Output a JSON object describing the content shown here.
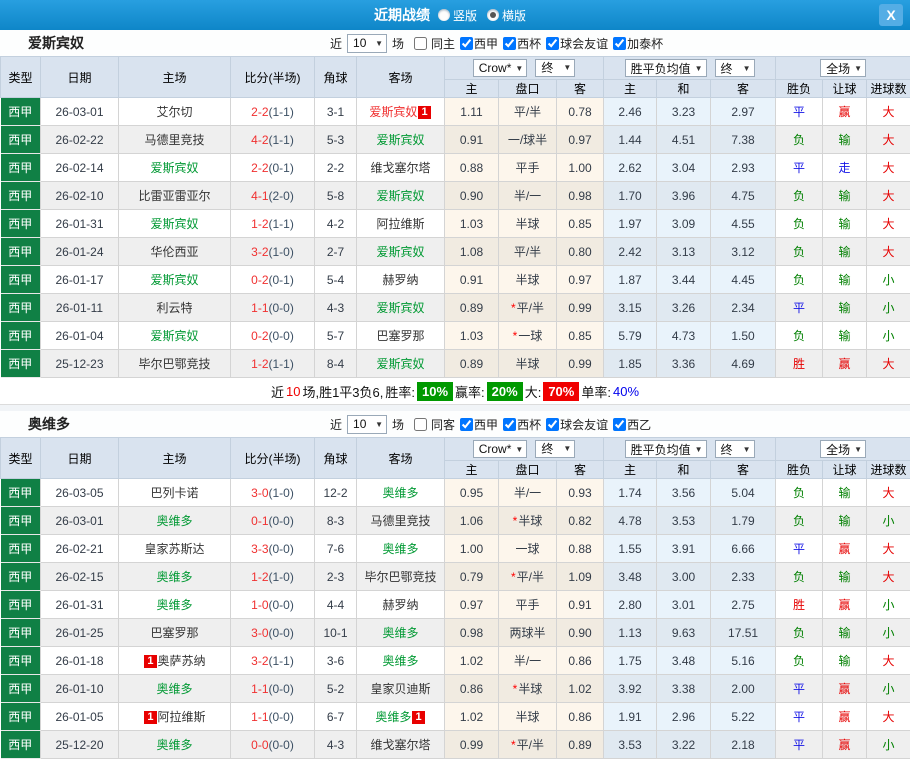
{
  "title_bar": {
    "title": "近期战绩",
    "radio_vertical": "竖版",
    "radio_horizontal": "横版",
    "selected": "横版",
    "close_label": "X"
  },
  "glyphs": {
    "star": "*",
    "dropdown_arrow": "▼"
  },
  "colors": {
    "titlebar_blue": "#1591da",
    "league_green": "#108045",
    "focus_team_green": "#009933",
    "win_box_green": "#009900",
    "loss_box_red": "#f00000",
    "draw_blue": "#1414e6"
  },
  "columns": {
    "type": "类型",
    "date": "日期",
    "home": "主场",
    "score": "比分(半场)",
    "corner": "角球",
    "away": "客场",
    "odds_home": "主",
    "odds_line": "盘口",
    "odds_away": "客",
    "mean_home": "主",
    "mean_draw": "和",
    "mean_away": "客",
    "result_wdl": "胜负",
    "result_ah": "让球",
    "result_ou": "进球数",
    "dd_crow": "Crow*",
    "dd_final1": "终",
    "dd_mean": "胜平负均值",
    "dd_final2": "终",
    "dd_fulltime": "全场"
  },
  "section1": {
    "team": "爱斯宾奴",
    "near": "近",
    "count": "10",
    "games": "场",
    "same": "同主",
    "comps": [
      "西甲",
      "西杯",
      "球会友谊",
      "加泰杯"
    ],
    "summary": {
      "near": "近",
      "count": "10",
      "body": "场,胜1平3负6, ",
      "win_label": "胜率:",
      "win_pct": "10%",
      "ah_label": "赢率:",
      "ah_pct": "20%",
      "ou_label": "大:",
      "ou_pct": "70%",
      "single_label": "单率:",
      "single_pct": "40%"
    },
    "rows": [
      {
        "lg": "西甲",
        "date": "26-03-01",
        "home": {
          "name": "艾尔切",
          "cls": "dark"
        },
        "score": {
          "ft": "2-2",
          "ht": "(1-1)"
        },
        "corner": "3-1",
        "away": {
          "name": "爱斯宾奴",
          "cls": "red",
          "post": "1"
        },
        "odds": {
          "h": "1.11",
          "line": "平/半",
          "star": false,
          "a": "0.78"
        },
        "mean": {
          "h": "2.46",
          "d": "3.23",
          "a": "2.97"
        },
        "res": {
          "wdl": "平",
          "ah": "赢",
          "ou": "大"
        }
      },
      {
        "lg": "西甲",
        "date": "26-02-22",
        "home": {
          "name": "马德里竞技",
          "cls": "dark"
        },
        "score": {
          "ft": "4-2",
          "ht": "(1-1)"
        },
        "corner": "5-3",
        "away": {
          "name": "爱斯宾奴",
          "cls": "green"
        },
        "odds": {
          "h": "0.91",
          "line": "一/球半",
          "star": false,
          "a": "0.97"
        },
        "mean": {
          "h": "1.44",
          "d": "4.51",
          "a": "7.38"
        },
        "res": {
          "wdl": "负",
          "ah": "输",
          "ou": "大"
        }
      },
      {
        "lg": "西甲",
        "date": "26-02-14",
        "home": {
          "name": "爱斯宾奴",
          "cls": "green"
        },
        "score": {
          "ft": "2-2",
          "ht": "(0-1)"
        },
        "corner": "2-2",
        "away": {
          "name": "维戈塞尔塔",
          "cls": "dark"
        },
        "odds": {
          "h": "0.88",
          "line": "平手",
          "star": false,
          "a": "1.00"
        },
        "mean": {
          "h": "2.62",
          "d": "3.04",
          "a": "2.93"
        },
        "res": {
          "wdl": "平",
          "ah": "走",
          "ou": "大"
        }
      },
      {
        "lg": "西甲",
        "date": "26-02-10",
        "home": {
          "name": "比雷亚雷亚尔",
          "cls": "dark"
        },
        "score": {
          "ft": "4-1",
          "ht": "(2-0)"
        },
        "corner": "5-8",
        "away": {
          "name": "爱斯宾奴",
          "cls": "green"
        },
        "odds": {
          "h": "0.90",
          "line": "半/一",
          "star": false,
          "a": "0.98"
        },
        "mean": {
          "h": "1.70",
          "d": "3.96",
          "a": "4.75"
        },
        "res": {
          "wdl": "负",
          "ah": "输",
          "ou": "大"
        }
      },
      {
        "lg": "西甲",
        "date": "26-01-31",
        "home": {
          "name": "爱斯宾奴",
          "cls": "green"
        },
        "score": {
          "ft": "1-2",
          "ht": "(1-1)"
        },
        "corner": "4-2",
        "away": {
          "name": "阿拉维斯",
          "cls": "dark"
        },
        "odds": {
          "h": "1.03",
          "line": "半球",
          "star": false,
          "a": "0.85"
        },
        "mean": {
          "h": "1.97",
          "d": "3.09",
          "a": "4.55"
        },
        "res": {
          "wdl": "负",
          "ah": "输",
          "ou": "大"
        }
      },
      {
        "lg": "西甲",
        "date": "26-01-24",
        "home": {
          "name": "华伦西亚",
          "cls": "dark"
        },
        "score": {
          "ft": "3-2",
          "ht": "(1-0)"
        },
        "corner": "2-7",
        "away": {
          "name": "爱斯宾奴",
          "cls": "green"
        },
        "odds": {
          "h": "1.08",
          "line": "平/半",
          "star": false,
          "a": "0.80"
        },
        "mean": {
          "h": "2.42",
          "d": "3.13",
          "a": "3.12"
        },
        "res": {
          "wdl": "负",
          "ah": "输",
          "ou": "大"
        }
      },
      {
        "lg": "西甲",
        "date": "26-01-17",
        "home": {
          "name": "爱斯宾奴",
          "cls": "green"
        },
        "score": {
          "ft": "0-2",
          "ht": "(0-1)"
        },
        "corner": "5-4",
        "away": {
          "name": "赫罗纳",
          "cls": "dark"
        },
        "odds": {
          "h": "0.91",
          "line": "半球",
          "star": false,
          "a": "0.97"
        },
        "mean": {
          "h": "1.87",
          "d": "3.44",
          "a": "4.45"
        },
        "res": {
          "wdl": "负",
          "ah": "输",
          "ou": "小"
        }
      },
      {
        "lg": "西甲",
        "date": "26-01-11",
        "home": {
          "name": "利云特",
          "cls": "dark"
        },
        "score": {
          "ft": "1-1",
          "ht": "(0-0)"
        },
        "corner": "4-3",
        "away": {
          "name": "爱斯宾奴",
          "cls": "green"
        },
        "odds": {
          "h": "0.89",
          "line": "平/半",
          "star": true,
          "a": "0.99"
        },
        "mean": {
          "h": "3.15",
          "d": "3.26",
          "a": "2.34"
        },
        "res": {
          "wdl": "平",
          "ah": "输",
          "ou": "小"
        }
      },
      {
        "lg": "西甲",
        "date": "26-01-04",
        "home": {
          "name": "爱斯宾奴",
          "cls": "green"
        },
        "score": {
          "ft": "0-2",
          "ht": "(0-0)"
        },
        "corner": "5-7",
        "away": {
          "name": "巴塞罗那",
          "cls": "dark"
        },
        "odds": {
          "h": "1.03",
          "line": "一球",
          "star": true,
          "a": "0.85"
        },
        "mean": {
          "h": "5.79",
          "d": "4.73",
          "a": "1.50"
        },
        "res": {
          "wdl": "负",
          "ah": "输",
          "ou": "小"
        }
      },
      {
        "lg": "西甲",
        "date": "25-12-23",
        "home": {
          "name": "毕尔巴鄂竞技",
          "cls": "dark"
        },
        "score": {
          "ft": "1-2",
          "ht": "(1-1)"
        },
        "corner": "8-4",
        "away": {
          "name": "爱斯宾奴",
          "cls": "green"
        },
        "odds": {
          "h": "0.89",
          "line": "半球",
          "star": false,
          "a": "0.99"
        },
        "mean": {
          "h": "1.85",
          "d": "3.36",
          "a": "4.69"
        },
        "res": {
          "wdl": "胜",
          "ah": "赢",
          "ou": "大"
        }
      }
    ]
  },
  "section2": {
    "team": "奥维多",
    "near": "近",
    "count": "10",
    "games": "场",
    "same": "同客",
    "comps": [
      "西甲",
      "西杯",
      "球会友谊",
      "西乙"
    ],
    "rows": [
      {
        "lg": "西甲",
        "date": "26-03-05",
        "home": {
          "name": "巴列卡诺",
          "cls": "dark"
        },
        "score": {
          "ft": "3-0",
          "ht": "(1-0)"
        },
        "corner": "12-2",
        "away": {
          "name": "奥维多",
          "cls": "green"
        },
        "odds": {
          "h": "0.95",
          "line": "半/一",
          "star": false,
          "a": "0.93"
        },
        "mean": {
          "h": "1.74",
          "d": "3.56",
          "a": "5.04"
        },
        "res": {
          "wdl": "负",
          "ah": "输",
          "ou": "大"
        }
      },
      {
        "lg": "西甲",
        "date": "26-03-01",
        "home": {
          "name": "奥维多",
          "cls": "green"
        },
        "score": {
          "ft": "0-1",
          "ht": "(0-0)"
        },
        "corner": "8-3",
        "away": {
          "name": "马德里竞技",
          "cls": "dark"
        },
        "odds": {
          "h": "1.06",
          "line": "半球",
          "star": true,
          "a": "0.82"
        },
        "mean": {
          "h": "4.78",
          "d": "3.53",
          "a": "1.79"
        },
        "res": {
          "wdl": "负",
          "ah": "输",
          "ou": "小"
        }
      },
      {
        "lg": "西甲",
        "date": "26-02-21",
        "home": {
          "name": "皇家苏斯达",
          "cls": "dark"
        },
        "score": {
          "ft": "3-3",
          "ht": "(0-0)"
        },
        "corner": "7-6",
        "away": {
          "name": "奥维多",
          "cls": "green"
        },
        "odds": {
          "h": "1.00",
          "line": "一球",
          "star": false,
          "a": "0.88"
        },
        "mean": {
          "h": "1.55",
          "d": "3.91",
          "a": "6.66"
        },
        "res": {
          "wdl": "平",
          "ah": "赢",
          "ou": "大"
        }
      },
      {
        "lg": "西甲",
        "date": "26-02-15",
        "home": {
          "name": "奥维多",
          "cls": "green"
        },
        "score": {
          "ft": "1-2",
          "ht": "(1-0)"
        },
        "corner": "2-3",
        "away": {
          "name": "毕尔巴鄂竞技",
          "cls": "dark"
        },
        "odds": {
          "h": "0.79",
          "line": "平/半",
          "star": true,
          "a": "1.09"
        },
        "mean": {
          "h": "3.48",
          "d": "3.00",
          "a": "2.33"
        },
        "res": {
          "wdl": "负",
          "ah": "输",
          "ou": "大"
        }
      },
      {
        "lg": "西甲",
        "date": "26-01-31",
        "home": {
          "name": "奥维多",
          "cls": "green"
        },
        "score": {
          "ft": "1-0",
          "ht": "(0-0)"
        },
        "corner": "4-4",
        "away": {
          "name": "赫罗纳",
          "cls": "dark"
        },
        "odds": {
          "h": "0.97",
          "line": "平手",
          "star": false,
          "a": "0.91"
        },
        "mean": {
          "h": "2.80",
          "d": "3.01",
          "a": "2.75"
        },
        "res": {
          "wdl": "胜",
          "ah": "赢",
          "ou": "小"
        }
      },
      {
        "lg": "西甲",
        "date": "26-01-25",
        "home": {
          "name": "巴塞罗那",
          "cls": "dark"
        },
        "score": {
          "ft": "3-0",
          "ht": "(0-0)"
        },
        "corner": "10-1",
        "away": {
          "name": "奥维多",
          "cls": "green"
        },
        "odds": {
          "h": "0.98",
          "line": "两球半",
          "star": false,
          "a": "0.90"
        },
        "mean": {
          "h": "1.13",
          "d": "9.63",
          "a": "17.51"
        },
        "res": {
          "wdl": "负",
          "ah": "输",
          "ou": "小"
        }
      },
      {
        "lg": "西甲",
        "date": "26-01-18",
        "home": {
          "name": "奥萨苏纳",
          "cls": "dark",
          "pre": "1"
        },
        "score": {
          "ft": "3-2",
          "ht": "(1-1)"
        },
        "corner": "3-6",
        "away": {
          "name": "奥维多",
          "cls": "green"
        },
        "odds": {
          "h": "1.02",
          "line": "半/一",
          "star": false,
          "a": "0.86"
        },
        "mean": {
          "h": "1.75",
          "d": "3.48",
          "a": "5.16"
        },
        "res": {
          "wdl": "负",
          "ah": "输",
          "ou": "大"
        }
      },
      {
        "lg": "西甲",
        "date": "26-01-10",
        "home": {
          "name": "奥维多",
          "cls": "green"
        },
        "score": {
          "ft": "1-1",
          "ht": "(0-0)"
        },
        "corner": "5-2",
        "away": {
          "name": "皇家贝迪斯",
          "cls": "dark"
        },
        "odds": {
          "h": "0.86",
          "line": "半球",
          "star": true,
          "a": "1.02"
        },
        "mean": {
          "h": "3.92",
          "d": "3.38",
          "a": "2.00"
        },
        "res": {
          "wdl": "平",
          "ah": "赢",
          "ou": "小"
        }
      },
      {
        "lg": "西甲",
        "date": "26-01-05",
        "home": {
          "name": "阿拉维斯",
          "cls": "dark",
          "pre": "1"
        },
        "score": {
          "ft": "1-1",
          "ht": "(0-0)"
        },
        "corner": "6-7",
        "away": {
          "name": "奥维多",
          "cls": "green",
          "post": "1"
        },
        "odds": {
          "h": "1.02",
          "line": "半球",
          "star": false,
          "a": "0.86"
        },
        "mean": {
          "h": "1.91",
          "d": "2.96",
          "a": "5.22"
        },
        "res": {
          "wdl": "平",
          "ah": "赢",
          "ou": "大"
        }
      },
      {
        "lg": "西甲",
        "date": "25-12-20",
        "home": {
          "name": "奥维多",
          "cls": "green"
        },
        "score": {
          "ft": "0-0",
          "ht": "(0-0)"
        },
        "corner": "4-3",
        "away": {
          "name": "维戈塞尔塔",
          "cls": "dark"
        },
        "odds": {
          "h": "0.99",
          "line": "平/半",
          "star": true,
          "a": "0.89"
        },
        "mean": {
          "h": "3.53",
          "d": "3.22",
          "a": "2.18"
        },
        "res": {
          "wdl": "平",
          "ah": "赢",
          "ou": "小"
        }
      }
    ]
  }
}
